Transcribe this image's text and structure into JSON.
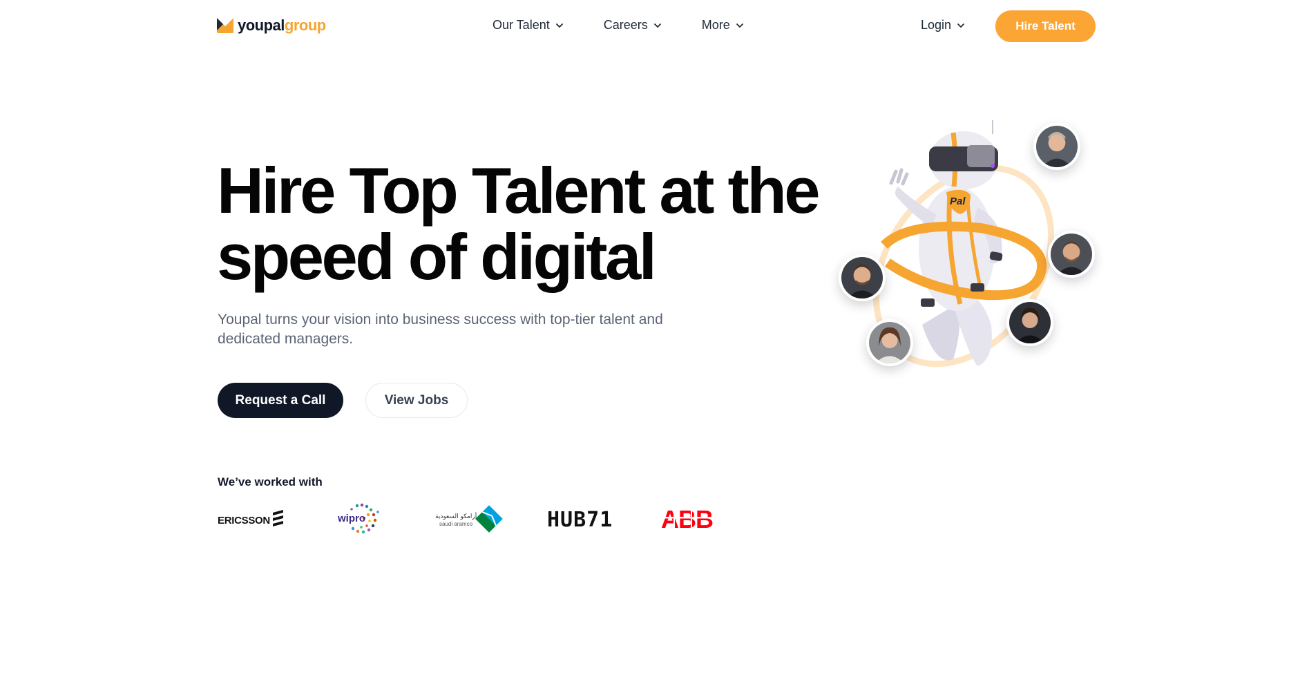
{
  "brand": {
    "name_a": "youpal",
    "name_b": "group",
    "logo_icon": "youpal-logo-icon"
  },
  "nav": {
    "items": [
      {
        "label": "Our Talent",
        "icon": "chevron-down-icon"
      },
      {
        "label": "Careers",
        "icon": "chevron-down-icon"
      },
      {
        "label": "More",
        "icon": "chevron-down-icon"
      }
    ],
    "login_label": "Login",
    "cta_label": "Hire Talent"
  },
  "hero": {
    "title_line1": "Hire Top Talent at the",
    "title_line2": "speed of digital",
    "subtitle_line1": "Youpal turns your vision into business success with top-tier talent and",
    "subtitle_line2": "dedicated managers.",
    "primary_cta": "Request a Call",
    "secondary_cta": "View Jobs"
  },
  "partners": {
    "heading": "We’ve worked with",
    "logos": [
      {
        "name": "ERICSSON"
      },
      {
        "name": "wipro"
      },
      {
        "name": "أرامكو السعودية",
        "name_en": "saudi aramco"
      },
      {
        "name": "HUB71"
      },
      {
        "name": "ABB"
      }
    ]
  },
  "illustration": {
    "robot_badge": "Pal"
  },
  "colors": {
    "accent": "#fba534",
    "dark": "#101828",
    "text_muted": "#5b6474",
    "abb_red": "#ff000f"
  }
}
